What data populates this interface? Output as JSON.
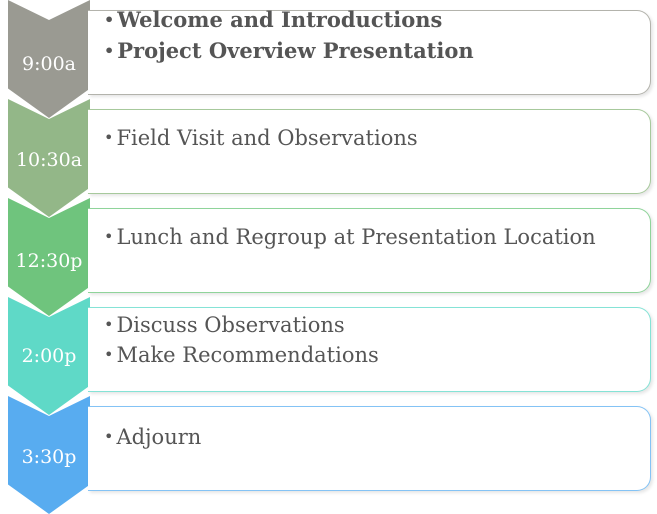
{
  "agenda": [
    {
      "time": "9:00a",
      "color": "#9a9a92",
      "border": "#b3b3ac",
      "bold": true,
      "items": [
        "Welcome and Introductions",
        "Project Overview Presentation"
      ]
    },
    {
      "time": "10:30a",
      "color": "#93b788",
      "border": "#a7c99c",
      "bold": false,
      "items": [
        "Field Visit and Observations"
      ]
    },
    {
      "time": "12:30p",
      "color": "#6fc47d",
      "border": "#8fd49a",
      "bold": false,
      "items": [
        "Lunch and Regroup at Presentation Location"
      ]
    },
    {
      "time": "2:00p",
      "color": "#5fd9c7",
      "border": "#85e3d6",
      "bold": false,
      "items": [
        "Discuss Observations",
        "Make Recommendations"
      ]
    },
    {
      "time": "3:30p",
      "color": "#58acf0",
      "border": "#84c3f5",
      "bold": false,
      "items": [
        "Adjourn"
      ]
    }
  ]
}
